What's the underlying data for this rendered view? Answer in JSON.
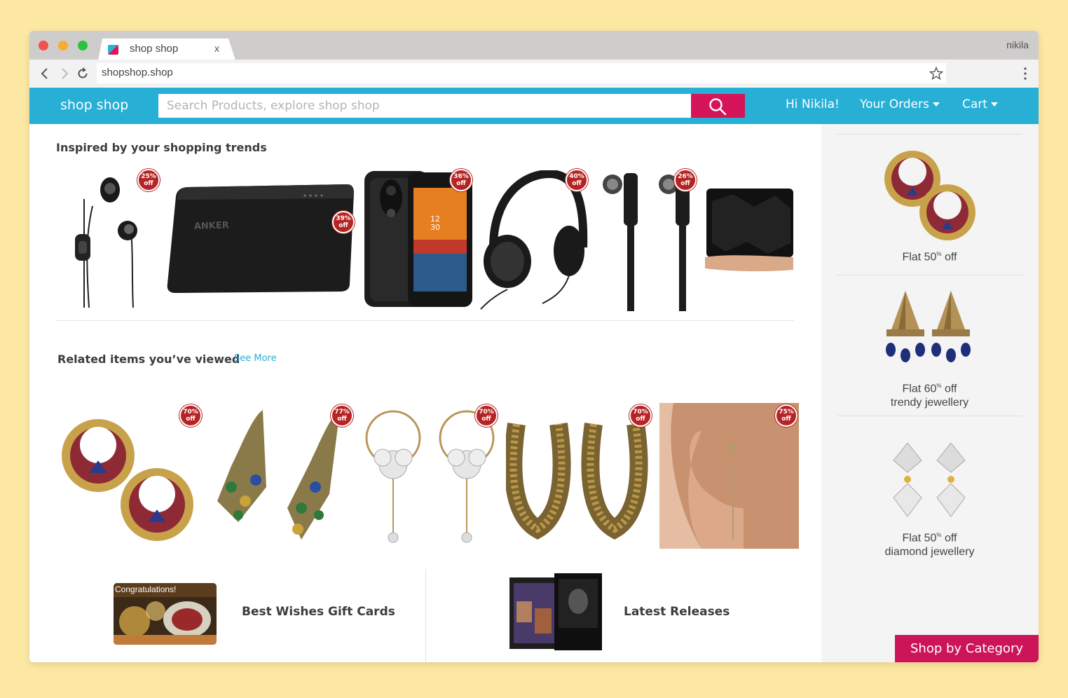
{
  "window": {
    "tab_title": "shop shop",
    "tab_close": "x",
    "profile": "nikila",
    "url": "shopshop.shop"
  },
  "header": {
    "brand": "shop shop",
    "search_placeholder": "Search Products, explore shop shop",
    "greeting": "Hi Nikila!",
    "orders_label": "Your Orders",
    "cart_label": "Cart"
  },
  "trends": {
    "title": "Inspired by your shopping trends",
    "items": [
      {
        "icon": "earphones-icon",
        "badge_pct": "25%",
        "badge_off": "off"
      },
      {
        "icon": "power-bank-icon",
        "badge_pct": "39%",
        "badge_off": "off"
      },
      {
        "icon": "phone-case-icon",
        "badge_pct": "36%",
        "badge_off": "off"
      },
      {
        "icon": "headphones-icon",
        "badge_pct": "40%",
        "badge_off": "off"
      },
      {
        "icon": "in-ear-earphones-icon",
        "badge_pct": "26%",
        "badge_off": "off"
      },
      {
        "icon": "speaker-icon"
      }
    ]
  },
  "related": {
    "title": "Related items you’ve viewed",
    "see_more": "See More",
    "items": [
      {
        "icon": "hoop-earrings-icon",
        "badge_pct": "70%",
        "badge_off": "off"
      },
      {
        "icon": "peacock-earrings-icon",
        "badge_pct": "77%",
        "badge_off": "off"
      },
      {
        "icon": "crystal-earrings-icon",
        "badge_pct": "70%",
        "badge_off": "off"
      },
      {
        "icon": "gold-bead-earrings-icon",
        "badge_pct": "70%",
        "badge_off": "off"
      },
      {
        "icon": "threader-earring-icon",
        "badge_pct": "75%",
        "badge_off": "off"
      }
    ]
  },
  "bottom": {
    "gift_card_text": "Congratulations!",
    "gift_label": "Best Wishes Gift  Cards",
    "releases_label": "Latest Releases"
  },
  "sidebar": {
    "promos": [
      {
        "pct": "Flat 50",
        "sup": "%",
        "rest": " off",
        "line2": ""
      },
      {
        "pct": "Flat 60",
        "sup": "%",
        "rest": " off",
        "line2": "trendy jewellery"
      },
      {
        "pct": "Flat 50",
        "sup": "%",
        "rest": " off",
        "line2": "diamond jewellery"
      }
    ],
    "shop_by_category": "Shop by Category"
  },
  "colors": {
    "header_blue": "#27afd6",
    "accent_pink": "#d5145a",
    "badge_red": "#b52424"
  }
}
